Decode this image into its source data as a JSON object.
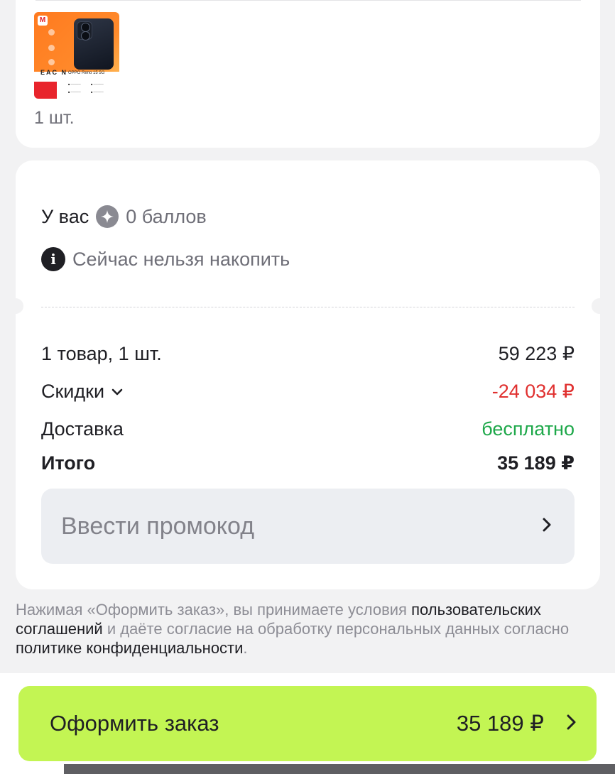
{
  "product": {
    "image_caption": "OPPO Reno 15 5G",
    "quantity": "1 шт."
  },
  "points": {
    "prefix": "У вас",
    "value": "0 баллов",
    "icon": "star-icon",
    "info": "Сейчас нельзя накопить"
  },
  "summary": {
    "items_label": "1 товар, 1 шт.",
    "items_value": "59 223 ₽",
    "discounts_label": "Скидки",
    "discounts_value": "-24 034 ₽",
    "delivery_label": "Доставка",
    "delivery_value": "бесплатно",
    "total_label": "Итого",
    "total_value": "35 189 ₽"
  },
  "promo": {
    "label": "Ввести промокод"
  },
  "legal": {
    "part1": "Нажимая «Оформить заказ», вы принимаете условия ",
    "link1": "пользовательских соглашений",
    "part2": " и даёте согласие на обработку персональных данных согласно ",
    "link2": "политике конфиденциальности",
    "part3": "."
  },
  "checkout": {
    "label": "Оформить заказ",
    "price": "35 189 ₽"
  },
  "colors": {
    "accent": "#c3f553",
    "discount": "#e0302f",
    "delivery": "#1ea84a"
  }
}
